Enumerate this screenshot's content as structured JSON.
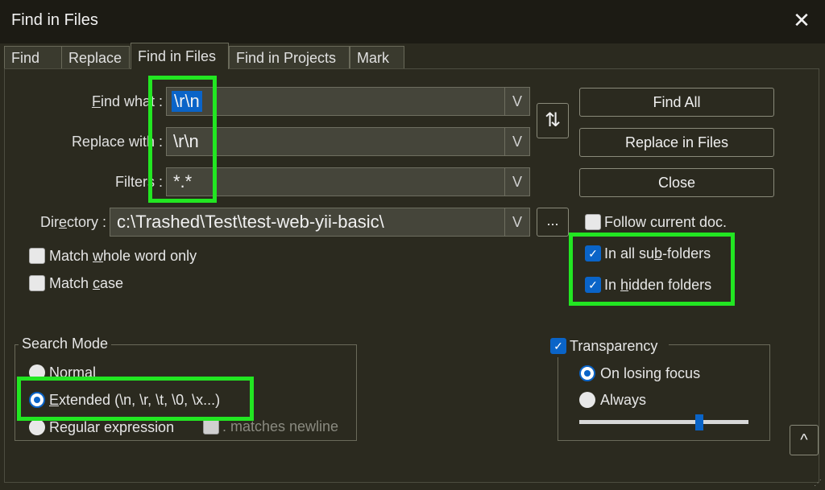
{
  "window": {
    "title": "Find in Files",
    "close_glyph": "✕"
  },
  "tabs": [
    {
      "label": "Find",
      "active": false
    },
    {
      "label": "Replace",
      "active": false
    },
    {
      "label": "Find in Files",
      "active": true
    },
    {
      "label": "Find in Projects",
      "active": false
    },
    {
      "label": "Mark",
      "active": false
    }
  ],
  "fields": {
    "find_what": {
      "label_pre": "",
      "label_key": "F",
      "label_post": "ind what :",
      "value": "\\r\\n"
    },
    "replace_with": {
      "label": "Replace with :",
      "value": "\\r\\n"
    },
    "filters": {
      "label": "Filters :",
      "value": "*.*"
    },
    "directory": {
      "label_pre": "Dir",
      "label_key": "e",
      "label_post": "ctory :",
      "value": "c:\\Trashed\\Test\\test-web-yii-basic\\"
    },
    "dropdown_glyph": "V"
  },
  "buttons": {
    "find_all": "Find All",
    "replace_in_files": "Replace in Files",
    "close": "Close",
    "swap_glyph": "⇅",
    "browse": "...",
    "collapse_glyph": "^"
  },
  "options": {
    "match_whole_word": {
      "pre": "Match ",
      "key": "w",
      "post": "hole word only",
      "checked": false
    },
    "match_case": {
      "pre": "Match ",
      "key": "c",
      "post": "ase",
      "checked": false
    },
    "follow_current_doc": {
      "label": "Follow current doc.",
      "checked": false
    },
    "in_all_subfolders": {
      "pre": "In all su",
      "key": "b",
      "post": "-folders",
      "checked": true
    },
    "in_hidden_folders": {
      "pre": "In ",
      "key": "h",
      "post": "idden folders",
      "checked": true
    }
  },
  "search_mode": {
    "title": "Search Mode",
    "normal": "Normal",
    "extended": {
      "key": "E",
      "post": "xtended (\\n, \\r, \\t, \\0, \\x...)"
    },
    "regex": "Regular expression",
    "matches_newline": ". matches newline",
    "selected": "extended"
  },
  "transparency": {
    "label": "Transparency",
    "checked": true,
    "on_losing_focus": "On losing focus",
    "always": "Always",
    "selected": "on_losing_focus",
    "level": 0.71
  },
  "colors": {
    "highlight": "#22e622",
    "accent": "#0a64c8",
    "background": "#2b2a1f"
  }
}
